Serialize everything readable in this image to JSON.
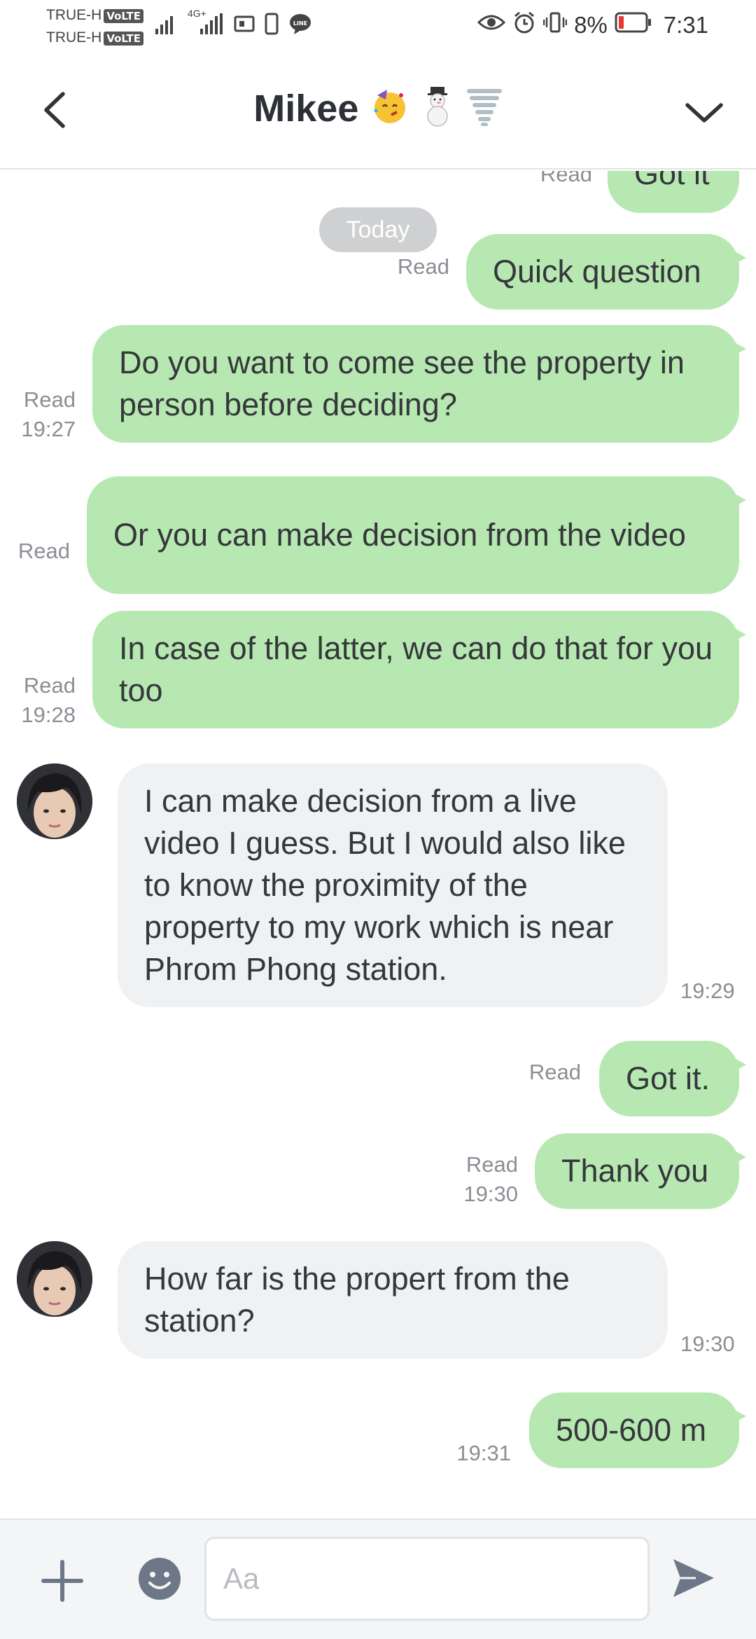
{
  "status_bar": {
    "carrier_1": "TRUE-H",
    "carrier_2": "TRUE-H",
    "volte_badge": "VoLTE",
    "network_label": "4G+",
    "battery_percent": "8%",
    "time": "7:31",
    "icons": [
      "signal-icon",
      "signal-4g-icon",
      "sim-icon",
      "phone-icon",
      "line-icon",
      "eye-icon",
      "alarm-icon",
      "vibrate-icon",
      "battery-icon"
    ]
  },
  "header": {
    "title": "Mikee",
    "title_emojis": [
      "party-face-emoji",
      "snowman-emoji",
      "tornado-emoji"
    ],
    "back_icon": "chevron-left-icon",
    "menu_icon": "chevron-down-icon"
  },
  "chat": {
    "date_separator": "Today",
    "messages": [
      {
        "dir": "out",
        "text": "Got it",
        "status": "Read",
        "time": ""
      },
      {
        "dir": "out",
        "text": "Quick question",
        "status": "Read",
        "time": ""
      },
      {
        "dir": "out",
        "text": "Do you want to come see the property in person before deciding?",
        "status": "Read",
        "time": "19:27"
      },
      {
        "dir": "out",
        "text": "Or you can make decision from the video",
        "status": "Read",
        "time": ""
      },
      {
        "dir": "out",
        "text": "In case of the latter, we can do that for you too",
        "status": "Read",
        "time": "19:28"
      },
      {
        "dir": "in",
        "text": "I can make decision from a live video I guess. But I would also like to know the proximity of the property to my work which is near Phrom Phong station.",
        "time": "19:29"
      },
      {
        "dir": "out",
        "text": "Got it.",
        "status": "Read",
        "time": ""
      },
      {
        "dir": "out",
        "text": "Thank you",
        "status": "Read",
        "time": "19:30"
      },
      {
        "dir": "in",
        "text": "How far is the propert from the station?",
        "time": "19:30"
      },
      {
        "dir": "out",
        "text": "500-600 m",
        "status": "",
        "time": "19:31"
      }
    ]
  },
  "input_bar": {
    "placeholder": "Aa",
    "value": "",
    "plus_icon": "plus-icon",
    "emoji_icon": "smiley-icon",
    "send_icon": "send-icon"
  },
  "colors": {
    "outgoing_bubble": "#b7e8b1",
    "incoming_bubble": "#f0f1f3",
    "date_pill": "#cfd0d2",
    "meta_text": "#8b8e94",
    "icon_gray": "#6e7787"
  }
}
